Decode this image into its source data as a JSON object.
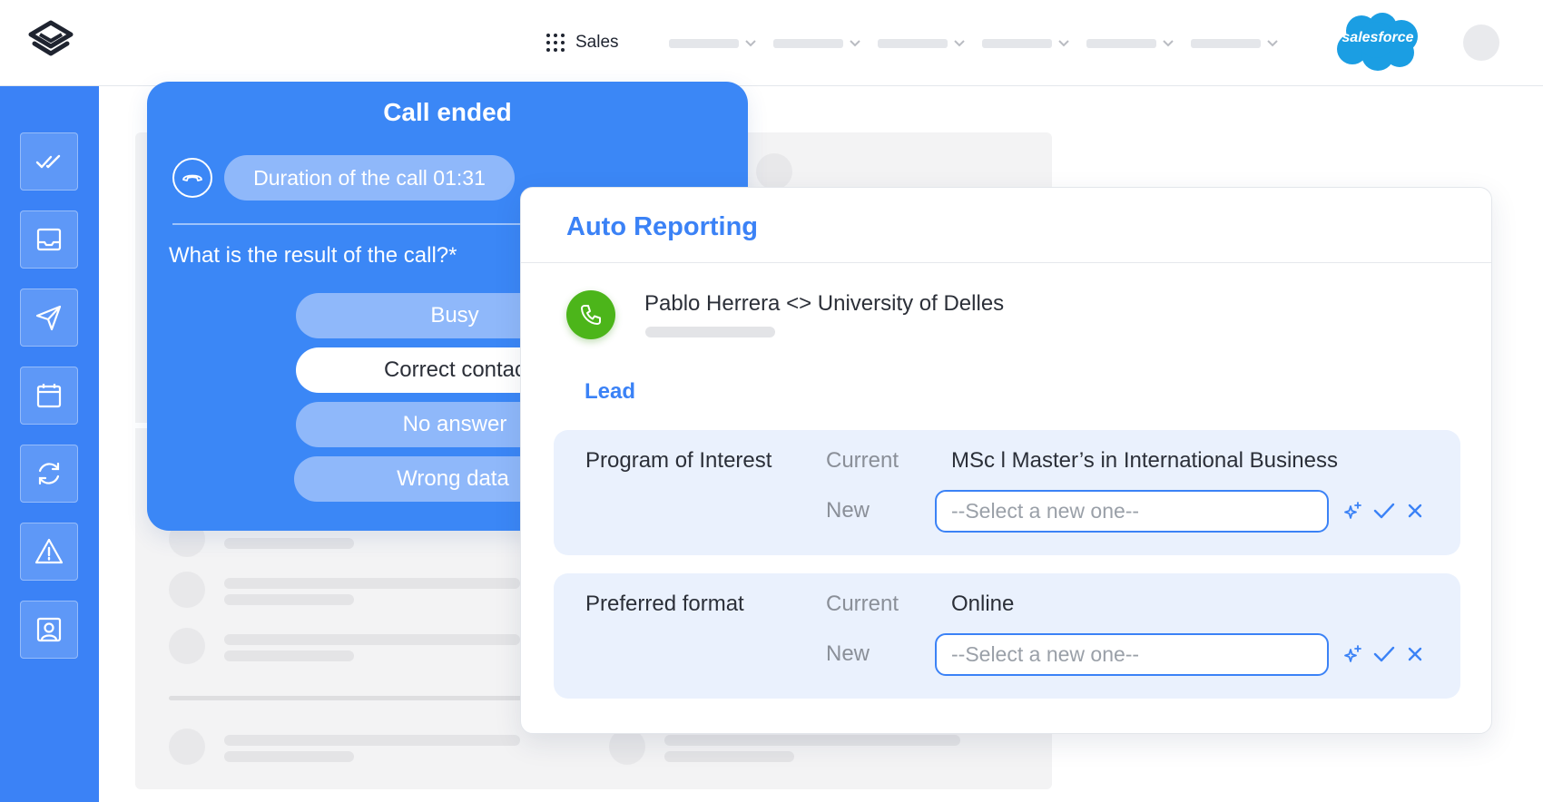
{
  "topbar": {
    "app_label": "Sales",
    "brand_logo": "salesforce",
    "nav_menus": 6
  },
  "sidebar": {
    "items": [
      {
        "icon": "double-check-icon"
      },
      {
        "icon": "inbox-icon"
      },
      {
        "icon": "send-icon"
      },
      {
        "icon": "calendar-icon"
      },
      {
        "icon": "sync-icon"
      },
      {
        "icon": "warning-icon"
      },
      {
        "icon": "contact-card-icon"
      }
    ]
  },
  "call_card": {
    "title": "Call ended",
    "duration": "Duration of the call 01:31",
    "question": "What is the result of the call?*",
    "options": [
      "Busy",
      "Correct contac",
      "No answer",
      "Wrong data"
    ],
    "selected_option": "Correct contac"
  },
  "auto_reporting": {
    "title": "Auto Reporting",
    "contact": "Pablo Herrera <> University of Delles",
    "section": "Lead",
    "fields": [
      {
        "label": "Program of Interest",
        "current_label": "Current",
        "current_value": "MSc l Master’s in International Business",
        "new_label": "New",
        "placeholder": "--Select a new one--"
      },
      {
        "label": "Preferred format",
        "current_label": "Current",
        "current_value": "Online",
        "new_label": "New",
        "placeholder": "--Select a new one--"
      }
    ]
  },
  "colors": {
    "accent": "#3b82f6",
    "call_card": "#3b87f6",
    "phone_badge": "#4cb51a",
    "field_bg": "#eaf1fd",
    "salesforce": "#1b9ee3"
  }
}
